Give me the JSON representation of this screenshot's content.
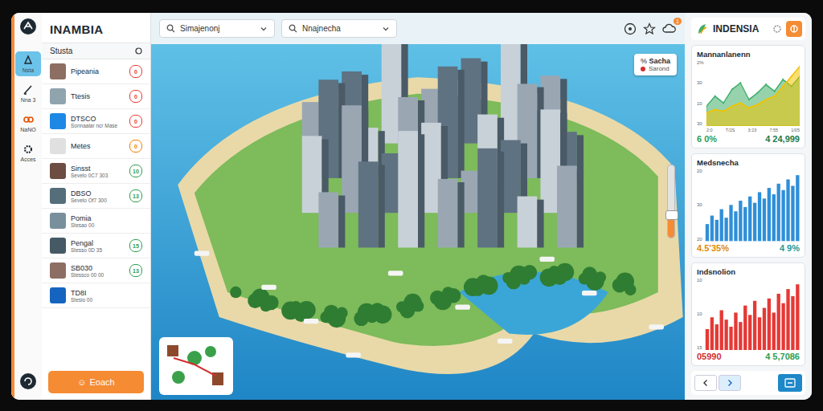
{
  "app": {
    "title": "INAMBIA"
  },
  "rail": [
    {
      "label": "Nsta",
      "selected": true
    },
    {
      "label": "Nna 3",
      "selected": false
    },
    {
      "label": "NaNO",
      "selected": false
    },
    {
      "label": "Acces",
      "selected": false
    }
  ],
  "section": {
    "title": "Stusta"
  },
  "items": [
    {
      "name": "Pipeania",
      "sub": "",
      "badge": {
        "text": "0",
        "color": "#e53935"
      }
    },
    {
      "name": "Ttesis",
      "sub": "",
      "badge": {
        "text": "0",
        "color": "#e53935"
      }
    },
    {
      "name": "DTSCO",
      "sub": "Sonnaalar ncr Mase",
      "badge": {
        "text": "0",
        "color": "#e53935"
      }
    },
    {
      "name": "Metes",
      "sub": "",
      "badge": {
        "text": "0",
        "color": "#f57c00"
      }
    },
    {
      "name": "Sinsst",
      "sub": "Sevelo 0C7 303",
      "badge": {
        "text": "10",
        "color": "#2e9e4f"
      }
    },
    {
      "name": "DBSO",
      "sub": "Sevelo Of7 300",
      "badge": {
        "text": "13",
        "color": "#2e9e4f"
      }
    },
    {
      "name": "Pomia",
      "sub": "Stesao 00",
      "badge": null
    },
    {
      "name": "Pengal",
      "sub": "Stesso 0D 35",
      "badge": {
        "text": "15",
        "color": "#2e9e4f"
      }
    },
    {
      "name": "SB030",
      "sub": "Stessco 00 00",
      "badge": {
        "text": "13",
        "color": "#2e9e4f"
      }
    },
    {
      "name": "TD8I",
      "sub": "Stesio 00",
      "badge": null
    }
  ],
  "action_button": {
    "label": "Eoach"
  },
  "search": [
    {
      "value": "Simajenonj"
    },
    {
      "value": "Nnajnecha"
    }
  ],
  "toolbar": {
    "notifications": "1"
  },
  "map": {
    "legend": {
      "prefix": "%",
      "title": "Sacha",
      "items": [
        {
          "label": "Sarond",
          "color": "#d32f2f"
        }
      ]
    },
    "zoom_level": 0.3
  },
  "right": {
    "title": "INDENSIA",
    "cards": [
      {
        "title": "Mannanlanenn",
        "kind": "area",
        "y_ticks": [
          "2%",
          "30",
          "10",
          "30"
        ],
        "x_ticks": [
          "2:0",
          "T/2S",
          "3:23",
          "7:55",
          "1/05"
        ],
        "series": [
          {
            "values": [
              12,
              18,
              14,
              22,
              26,
              16,
              20,
              25,
              21,
              28,
              24,
              30
            ],
            "color": "#3fae6a"
          },
          {
            "values": [
              8,
              10,
              9,
              12,
              14,
              11,
              13,
              16,
              18,
              24,
              30,
              36
            ],
            "color": "#f2c200"
          }
        ],
        "stats": [
          {
            "text": "6 0%",
            "color": "#2e9e4f"
          },
          {
            "text": "4 24,999",
            "color": "#1f7a48"
          }
        ]
      },
      {
        "title": "Medsnecha",
        "kind": "bars",
        "y_ticks": [
          "20",
          "30",
          "20"
        ],
        "x_ticks": [],
        "series": [
          {
            "values": [
              8,
              12,
              10,
              15,
              11,
              17,
              14,
              19,
              16,
              21,
              18,
              23,
              20,
              25,
              22,
              27,
              24,
              29,
              26,
              31
            ],
            "color": "#2f8fd8"
          }
        ],
        "stats": [
          {
            "text": "4.5'35%",
            "color": "#e08a00"
          },
          {
            "text": "4 9%",
            "color": "#1a9a9a"
          }
        ]
      },
      {
        "title": "Indsnolion",
        "kind": "bars",
        "y_ticks": [
          "10",
          "10",
          "15"
        ],
        "x_ticks": [],
        "series": [
          {
            "values": [
              9,
              14,
              11,
              17,
              13,
              10,
              16,
              12,
              19,
              15,
              21,
              14,
              18,
              22,
              16,
              24,
              20,
              26,
              23,
              28
            ],
            "color": "#e53935"
          }
        ],
        "stats": [
          {
            "text": "05990",
            "color": "#d32f2f"
          },
          {
            "text": "4 5,7086",
            "color": "#2e9e4f"
          }
        ]
      }
    ]
  }
}
